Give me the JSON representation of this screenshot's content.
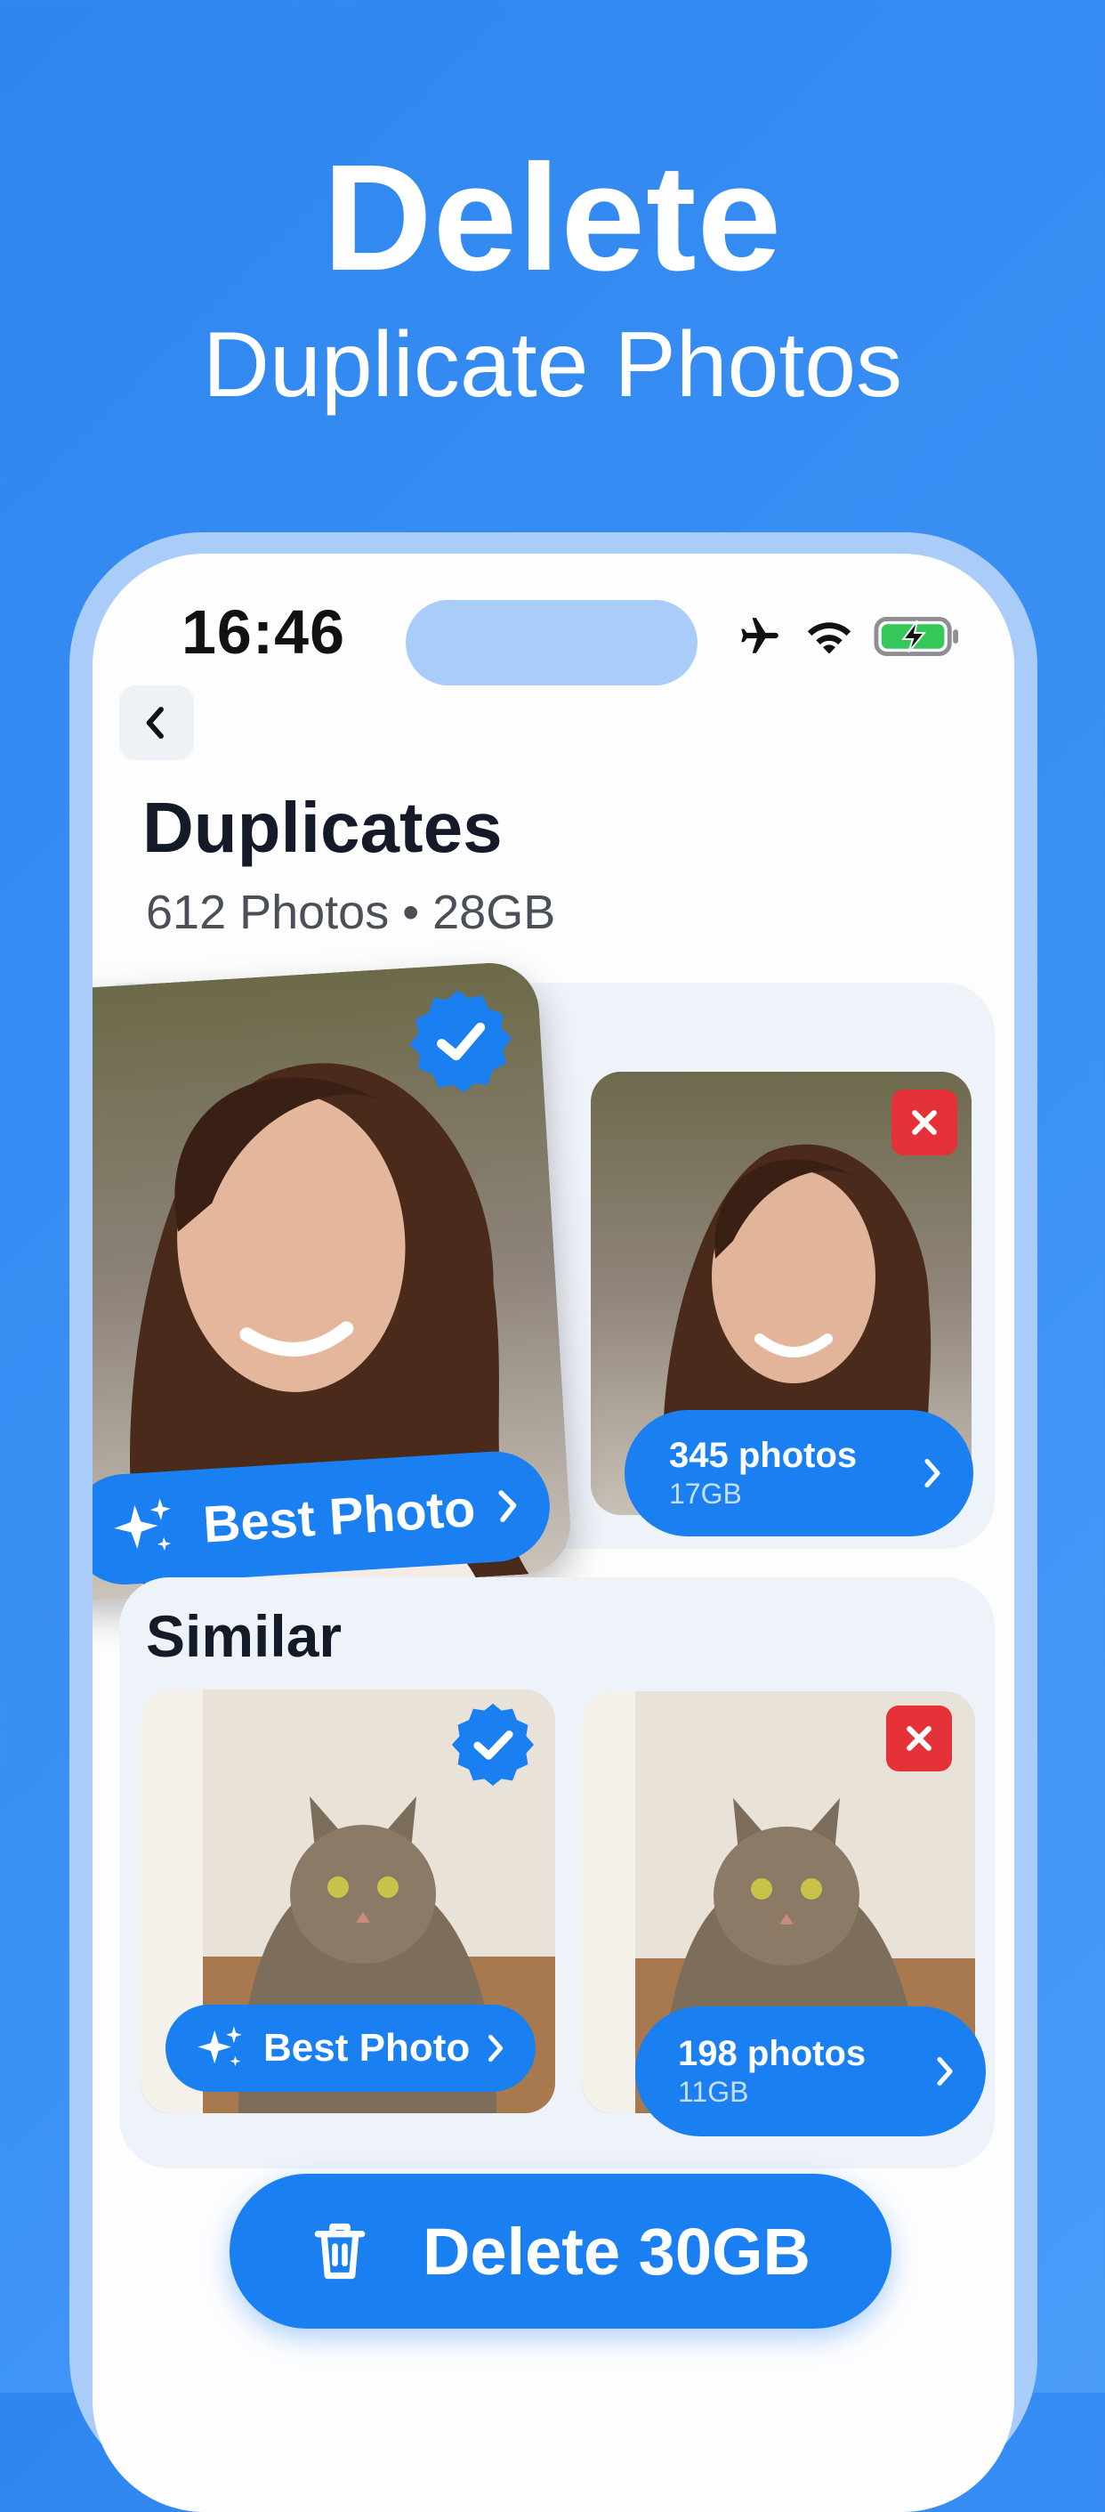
{
  "hero": {
    "title": "Delete",
    "subtitle": "Duplicate Photos"
  },
  "status_bar": {
    "time": "16:46",
    "icons": [
      "airplane-icon",
      "wifi-icon",
      "battery-charging-icon"
    ]
  },
  "header": {
    "title": "Duplicates",
    "summary": "612 Photos • 28GB"
  },
  "duplicates": {
    "best": {
      "label": "Best Photo",
      "selected": true
    },
    "other": {
      "count": "345 photos",
      "size": "17GB",
      "marked_delete": true
    }
  },
  "similar": {
    "title": "Similar",
    "best": {
      "label": "Best Photo",
      "selected": true
    },
    "other": {
      "count": "198 photos",
      "size": "11GB",
      "marked_delete": true
    }
  },
  "delete_button": {
    "label": "Delete 30GB"
  },
  "colors": {
    "accent": "#1a7ff0",
    "background": "#2f86ef",
    "danger": "#e53138",
    "card": "#eef2f9"
  }
}
